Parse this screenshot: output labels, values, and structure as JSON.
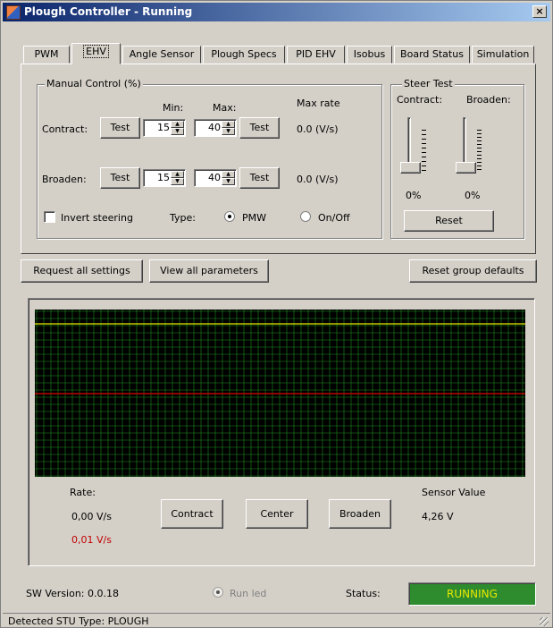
{
  "window": {
    "title": "Plough Controller - Running",
    "close_glyph": "×"
  },
  "tabs": [
    {
      "label": "PWM"
    },
    {
      "label": "EHV"
    },
    {
      "label": "Angle Sensor"
    },
    {
      "label": "Plough Specs"
    },
    {
      "label": "PID EHV"
    },
    {
      "label": "Isobus"
    },
    {
      "label": "Board Status"
    },
    {
      "label": "Simulation"
    }
  ],
  "active_tab": "EHV",
  "manual": {
    "legend": "Manual Control (%)",
    "min_label": "Min:",
    "max_label": "Max:",
    "max_rate_label": "Max rate",
    "contract": {
      "label": "Contract:",
      "test1": "Test",
      "min": "15",
      "max": "40",
      "test2": "Test",
      "rate": "0.0  (V/s)"
    },
    "broaden": {
      "label": "Broaden:",
      "test1": "Test",
      "min": "15",
      "max": "40",
      "test2": "Test",
      "rate": "0.0  (V/s)"
    },
    "invert_label": "Invert steering",
    "invert_checked": false,
    "type_label": "Type:",
    "type_options": [
      "PMW",
      "On/Off"
    ],
    "type_selected": "PMW"
  },
  "steer": {
    "legend": "Steer Test",
    "contract_label": "Contract:",
    "broaden_label": "Broaden:",
    "contract_pct": "0%",
    "broaden_pct": "0%",
    "contract_level": 0,
    "broaden_level": 0,
    "reset": "Reset"
  },
  "toolbar": {
    "request": "Request all settings",
    "view": "View all parameters",
    "reset_group": "Reset group defaults"
  },
  "graph": {
    "rate_label": "Rate:",
    "rate1": "0,00 V/s",
    "rate2": "0,01 V/s",
    "contract_btn": "Contract",
    "center_btn": "Center",
    "broaden_btn": "Broaden",
    "sensor_label": "Sensor Value",
    "sensor_value": "4,26 V",
    "colors": {
      "background": "#000000",
      "grid": "#1f8f1f",
      "yellow": "#e8e800",
      "red": "#e00000",
      "rate2": "#c00000"
    }
  },
  "footer": {
    "sw_version": "SW Version: 0.0.18",
    "run_led": "Run led",
    "status_label": "Status:",
    "status_value": "RUNNING",
    "status_bg": "#2e8b2e",
    "status_fg": "#e8e800",
    "detected": "Detected STU Type: PLOUGH"
  }
}
